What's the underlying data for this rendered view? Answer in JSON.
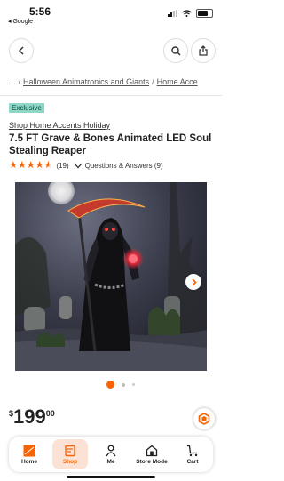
{
  "status_bar": {
    "time": "5:56",
    "back_app": "◂ Google"
  },
  "breadcrumb": {
    "ellipsis": "...",
    "items": [
      {
        "label": "Halloween Animatronics and Giants"
      },
      {
        "label": "Home Acce"
      }
    ]
  },
  "product": {
    "badge": "Exclusive",
    "brand": "Shop Home Accents Holiday",
    "title": "7.5 FT Grave & Bones Animated LED Soul Stealing Reaper",
    "rating": 4.5,
    "review_count": "(19)",
    "qa_label": "Questions & Answers (9)",
    "price": {
      "currency": "$",
      "dollars": "199",
      "cents": "00"
    }
  },
  "gallery": {
    "image_count": 3,
    "active_index": 0
  },
  "tab_bar": {
    "items": [
      {
        "label": "Home",
        "icon": "home-depot-logo-icon"
      },
      {
        "label": "Shop",
        "icon": "shop-icon"
      },
      {
        "label": "Me",
        "icon": "person-icon"
      },
      {
        "label": "Store Mode",
        "icon": "store-icon"
      },
      {
        "label": "Cart",
        "icon": "cart-icon"
      }
    ],
    "active": "Shop"
  },
  "colors": {
    "accent": "#f96302",
    "badge_bg": "#8fd6c7"
  }
}
